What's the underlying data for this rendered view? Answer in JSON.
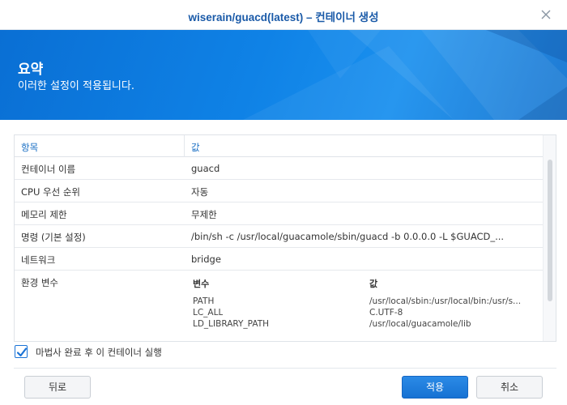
{
  "window": {
    "title": "wiserain/guacd(latest) – 컨테이너 생성"
  },
  "banner": {
    "title": "요약",
    "subtitle": "이러한 설정이 적용됩니다."
  },
  "table": {
    "headers": [
      "항목",
      "값"
    ],
    "rows": [
      {
        "key": "컨테이너 이름",
        "value": "guacd"
      },
      {
        "key": "CPU 우선 순위",
        "value": "자동"
      },
      {
        "key": "메모리 제한",
        "value": "무제한"
      },
      {
        "key": "명령 (기본 설정)",
        "value": "/bin/sh -c /usr/local/guacamole/sbin/guacd -b 0.0.0.0 -L $GUACD_..."
      },
      {
        "key": "네트워크",
        "value": "bridge"
      }
    ],
    "env": {
      "key": "환경 변수",
      "col_var": "변수",
      "col_val": "값",
      "items": [
        {
          "name": "PATH",
          "value": "/usr/local/sbin:/usr/local/bin:/usr/s..."
        },
        {
          "name": "LC_ALL",
          "value": "C.UTF-8"
        },
        {
          "name": "LD_LIBRARY_PATH",
          "value": "/usr/local/guacamole/lib"
        }
      ]
    }
  },
  "run_after": {
    "label": "마법사 완료 후 이 컨테이너 실행",
    "checked": true
  },
  "buttons": {
    "back": "뒤로",
    "apply": "적용",
    "cancel": "취소"
  },
  "colors": {
    "accent": "#1a73d6",
    "title": "#1a5aa8",
    "banner": "#0f82e6"
  }
}
